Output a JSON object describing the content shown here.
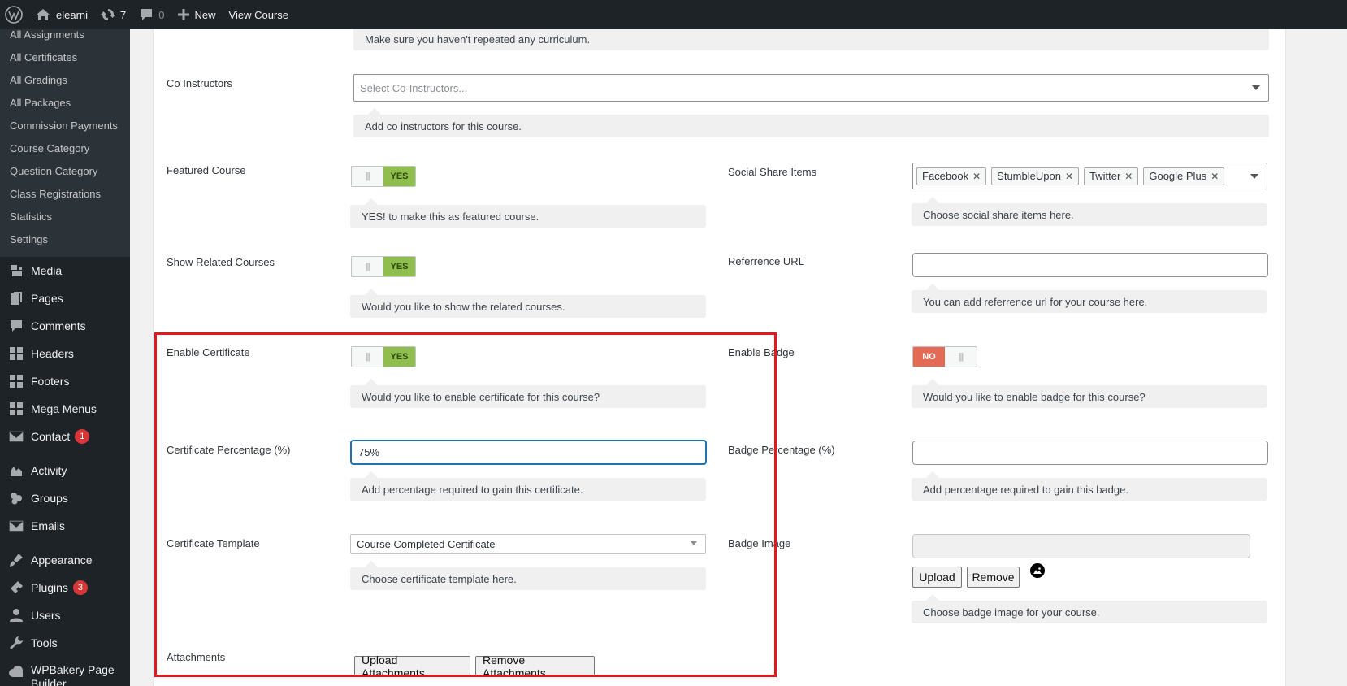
{
  "adminbar": {
    "site_name": "elearni",
    "updates_count": "7",
    "comments_count": "0",
    "new_label": "New",
    "view_label": "View Course"
  },
  "sidebar": {
    "submenu": [
      "All Assignments",
      "All Certificates",
      "All Gradings",
      "All Packages",
      "Commission Payments",
      "Course Category",
      "Question Category",
      "Class Registrations",
      "Statistics",
      "Settings"
    ],
    "group1": [
      {
        "label": "Media",
        "icon": "media-icon"
      },
      {
        "label": "Pages",
        "icon": "pages-icon"
      },
      {
        "label": "Comments",
        "icon": "comments-icon"
      },
      {
        "label": "Headers",
        "icon": "grid-icon"
      },
      {
        "label": "Footers",
        "icon": "grid-icon"
      },
      {
        "label": "Mega Menus",
        "icon": "grid-icon"
      },
      {
        "label": "Contact",
        "icon": "mail-icon",
        "badge": "1"
      }
    ],
    "group2": [
      {
        "label": "Activity",
        "icon": "activity-icon"
      },
      {
        "label": "Groups",
        "icon": "groups-icon"
      },
      {
        "label": "Emails",
        "icon": "mail-icon"
      }
    ],
    "group3": [
      {
        "label": "Appearance",
        "icon": "brush-icon"
      },
      {
        "label": "Plugins",
        "icon": "plugin-icon",
        "badge": "3"
      },
      {
        "label": "Users",
        "icon": "users-icon"
      },
      {
        "label": "Tools",
        "icon": "wrench-icon"
      },
      {
        "label": "WPBakery Page Builder",
        "icon": "cloud-icon"
      }
    ]
  },
  "form": {
    "curriculum_help": "Make sure you haven't repeated any curriculum.",
    "co_instructors": {
      "label": "Co Instructors",
      "placeholder": "Select Co-Instructors...",
      "help": "Add co instructors for this course."
    },
    "featured": {
      "label": "Featured Course",
      "state": "YES",
      "help": "YES! to make this as featured course."
    },
    "social": {
      "label": "Social Share Items",
      "tags": [
        "Facebook",
        "StumbleUpon",
        "Twitter",
        "Google Plus"
      ],
      "help": "Choose social share items here."
    },
    "related": {
      "label": "Show Related Courses",
      "state": "YES",
      "help": "Would you like to show the related courses."
    },
    "reference": {
      "label": "Referrence URL",
      "value": "",
      "help": "You can add referrence url for your course here."
    },
    "certificate": {
      "label": "Enable Certificate",
      "state": "YES",
      "help": "Would you like to enable certificate for this course?"
    },
    "badge": {
      "label": "Enable Badge",
      "state": "NO",
      "help": "Would you like to enable badge for this course?"
    },
    "cert_percentage": {
      "label": "Certificate Percentage (%)",
      "value": "75%",
      "help": "Add percentage required to gain this certificate."
    },
    "badge_percentage": {
      "label": "Badge Percentage (%)",
      "value": "",
      "help": "Add percentage required to gain this badge."
    },
    "cert_template": {
      "label": "Certificate Template",
      "value": "Course Completed Certificate",
      "help": "Choose certificate template here."
    },
    "badge_image": {
      "label": "Badge Image",
      "upload": "Upload",
      "remove": "Remove",
      "help": "Choose badge image for your course."
    },
    "attachments": {
      "label": "Attachments",
      "upload": "Upload Attachments",
      "remove": "Remove Attachments"
    }
  }
}
